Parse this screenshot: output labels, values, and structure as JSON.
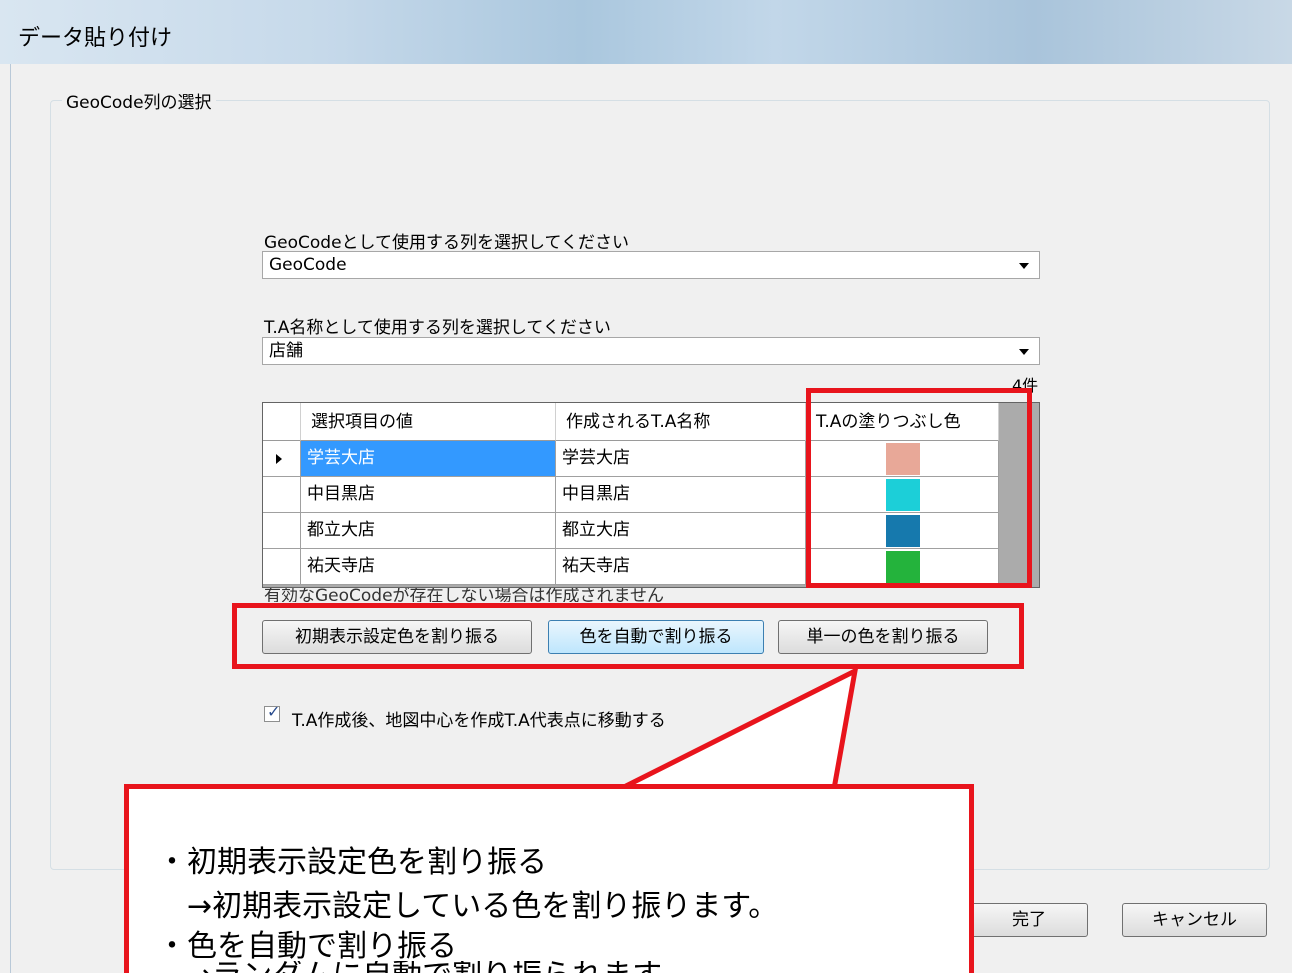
{
  "window": {
    "title": "データ貼り付け"
  },
  "group": {
    "label": "GeoCode列の選択"
  },
  "geocode": {
    "label": "GeoCodeとして使用する列を選択してください",
    "selected": "GeoCode"
  },
  "ta_name": {
    "label": "T.A名称として使用する列を選択してください",
    "selected": "店舗"
  },
  "grid": {
    "count": "4件",
    "columns": [
      "選択項目の値",
      "作成されるT.A名称",
      "T.Aの塗りつぶし色"
    ],
    "rows": [
      {
        "value": "学芸大店",
        "name": "学芸大店",
        "color": "#e8a898"
      },
      {
        "value": "中目黒店",
        "name": "中目黒店",
        "color": "#1ccfd8"
      },
      {
        "value": "都立大店",
        "name": "都立大店",
        "color": "#1679ad"
      },
      {
        "value": "祐天寺店",
        "name": "祐天寺店",
        "color": "#24b33c"
      }
    ],
    "note": "有効なGeoCodeが存在しない場合は作成されません"
  },
  "buttons": {
    "initial": "初期表示設定色を割り振る",
    "auto": "色を自動で割り振る",
    "single": "単一の色を割り振る",
    "finish": "完了",
    "cancel": "キャンセル"
  },
  "checkbox": {
    "label": "T.A作成後、地図中心を作成T.A代表点に移動する",
    "checked": true
  },
  "callout": {
    "line1": "・初期表示設定色を割り振る",
    "line2": "→初期表示設定している色を割り振ります。",
    "line3": "・色を自動で割り振る",
    "line4": "→ランダムに自動で割り振られます。"
  },
  "colors": {
    "highlight": "#e8141c",
    "selection": "#3399ff"
  }
}
